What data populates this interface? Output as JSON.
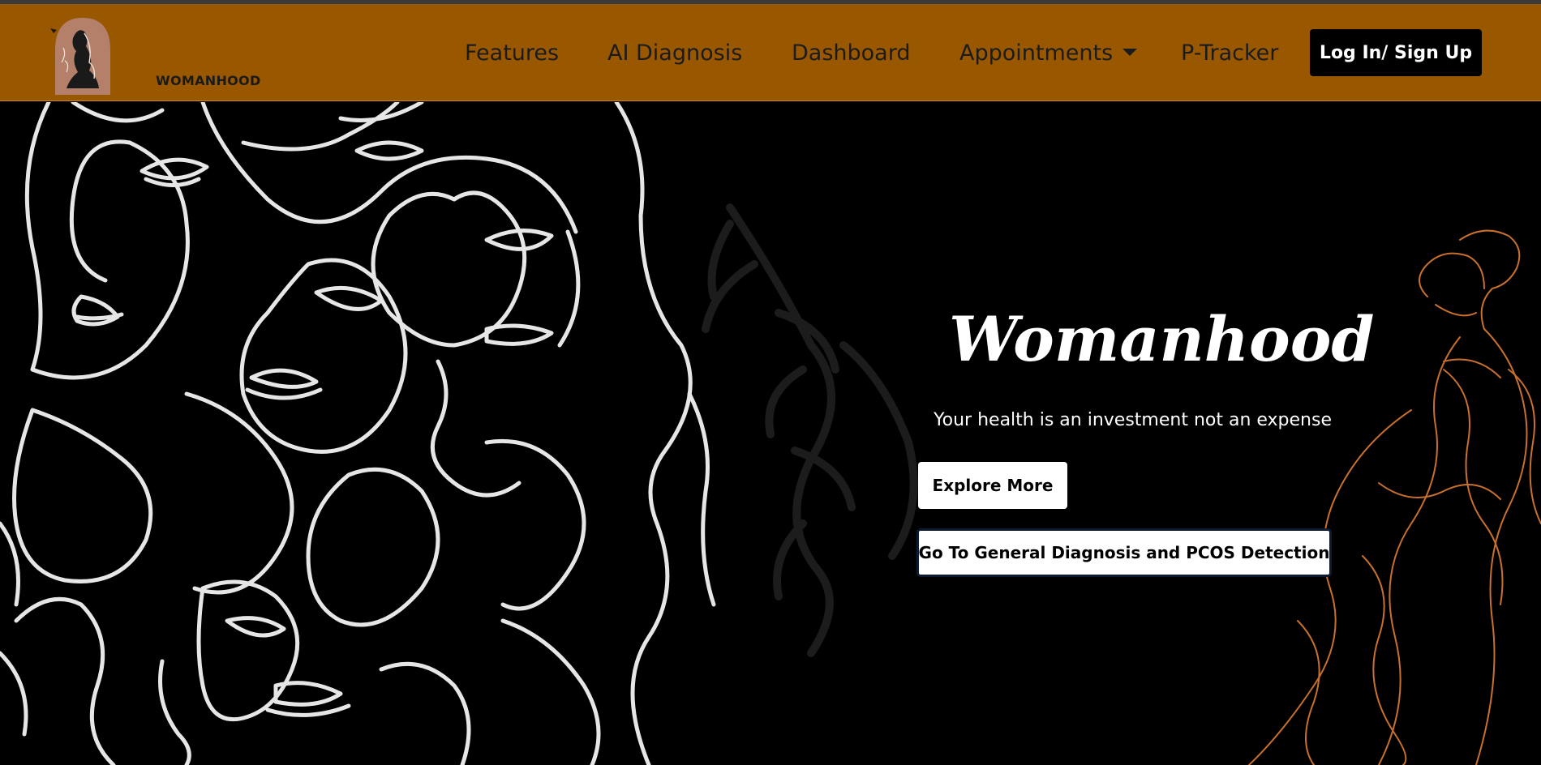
{
  "brand": {
    "name": "WOMANHOOD"
  },
  "nav": {
    "links": [
      {
        "label": "Features"
      },
      {
        "label": "AI Diagnosis"
      },
      {
        "label": "Dashboard"
      },
      {
        "label": "Appointments"
      },
      {
        "label": "P-Tracker"
      }
    ],
    "login_label": "Log In/ Sign Up"
  },
  "hero": {
    "title": "Womanhood",
    "subtitle": "Your health is an investment not an expense",
    "explore_label": "Explore More",
    "diagnosis_label": "Go To General Diagnosis and PCOS Detection"
  },
  "colors": {
    "navbar": "#995800",
    "background": "#000000",
    "line_art": "#e6e6e6",
    "accent_art": "#c8702e"
  }
}
